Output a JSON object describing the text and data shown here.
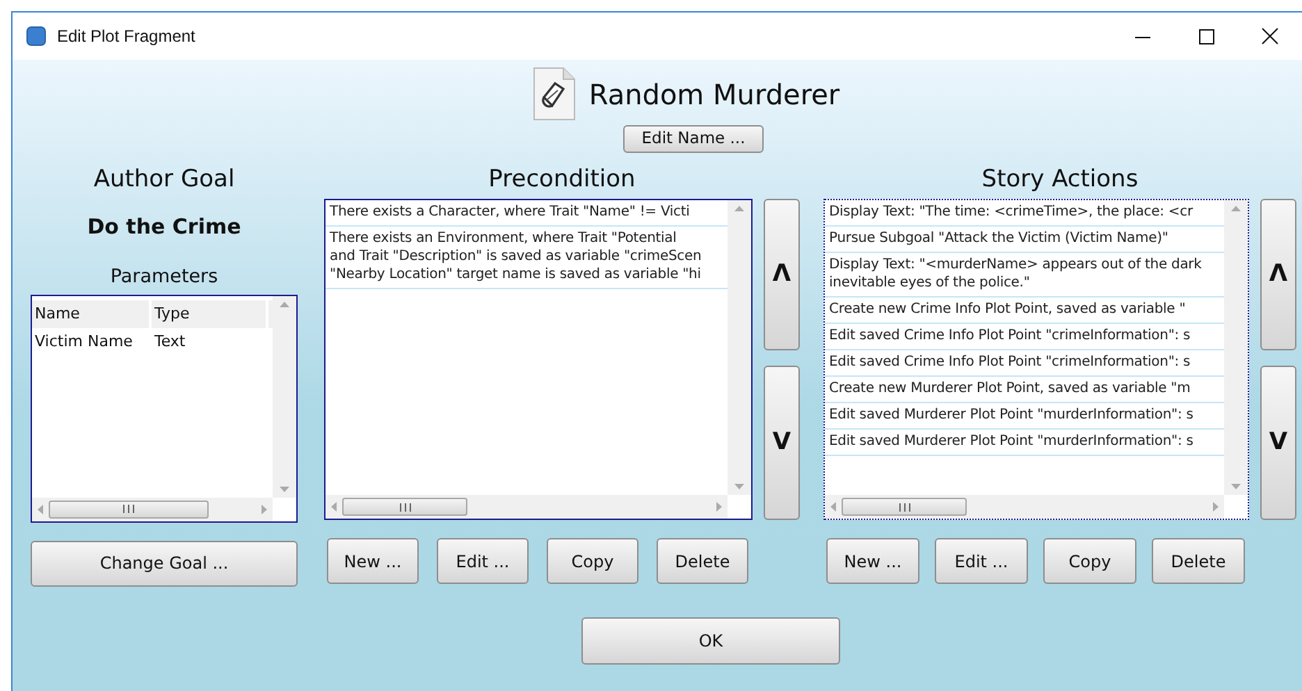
{
  "window": {
    "title": "Edit Plot Fragment"
  },
  "header": {
    "title": "Random Murderer",
    "edit_button": "Edit Name ..."
  },
  "author_goal": {
    "heading": "Author Goal",
    "goal_name": "Do the Crime",
    "parameters_label": "Parameters",
    "parameters_table": {
      "columns": [
        "Name",
        "Type"
      ],
      "rows": [
        [
          "Victim Name",
          "Text"
        ]
      ]
    },
    "change_button": "Change Goal ..."
  },
  "precondition": {
    "heading": "Precondition",
    "items": [
      {
        "lines": [
          "There exists a Character, where Trait \"Name\" != Victi"
        ]
      },
      {
        "lines": [
          "There exists an Environment, where Trait \"Potential",
          "and Trait \"Description\" is saved as variable \"crimeScen",
          "\"Nearby Location\" target name is saved as variable \"hi"
        ]
      }
    ],
    "move_buttons": [
      "Λ",
      "V"
    ],
    "buttons": [
      "New ...",
      "Edit ...",
      "Copy",
      "Delete"
    ]
  },
  "story_actions": {
    "heading": "Story Actions",
    "items": [
      {
        "lines": [
          "Display Text: \"The time: <crimeTime>, the place: <cr"
        ]
      },
      {
        "lines": [
          "Pursue Subgoal \"Attack the Victim (Victim Name)\""
        ]
      },
      {
        "lines": [
          "Display Text: \"<murderName> appears out of the dark",
          "inevitable eyes of the police.\""
        ]
      },
      {
        "lines": [
          "Create new Crime Info Plot Point, saved as variable \""
        ]
      },
      {
        "lines": [
          "Edit saved Crime Info Plot Point \"crimeInformation\": s"
        ]
      },
      {
        "lines": [
          "Edit saved Crime Info Plot Point \"crimeInformation\": s"
        ]
      },
      {
        "lines": [
          "Create new Murderer Plot Point, saved as variable \"m"
        ]
      },
      {
        "lines": [
          "Edit saved Murderer Plot Point \"murderInformation\": s"
        ]
      },
      {
        "lines": [
          "Edit saved Murderer Plot Point \"murderInformation\": s"
        ]
      }
    ],
    "move_buttons": [
      "Λ",
      "V"
    ],
    "buttons": [
      "New ...",
      "Edit ...",
      "Copy",
      "Delete"
    ]
  },
  "ok_button": "OK"
}
